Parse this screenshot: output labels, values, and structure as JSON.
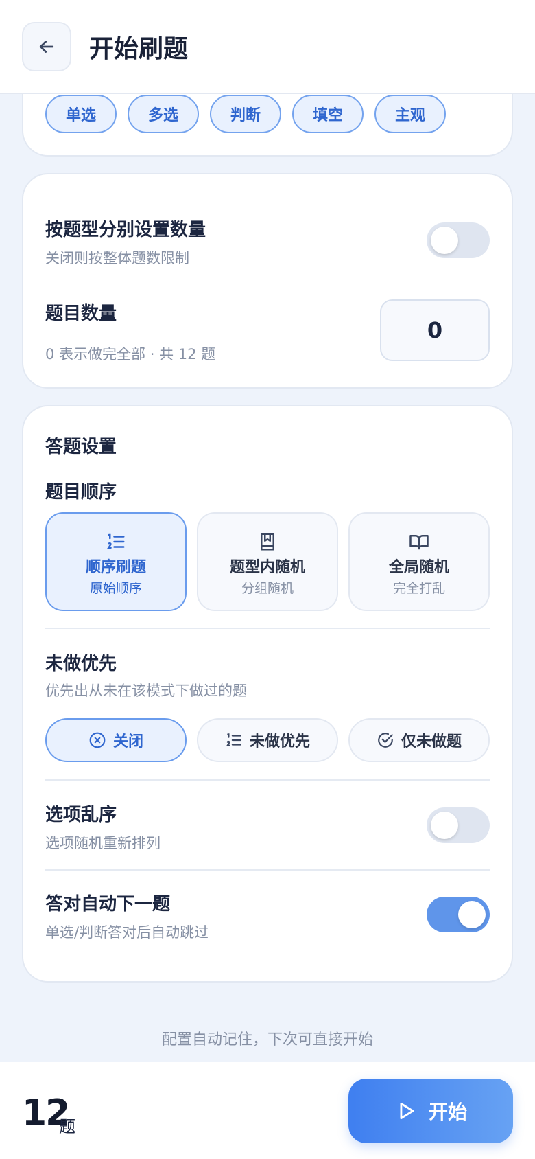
{
  "header": {
    "title": "开始刷题"
  },
  "question_types": {
    "chips": [
      "单选",
      "多选",
      "判断",
      "填空",
      "主观"
    ]
  },
  "quantity_card": {
    "per_type_title": "按题型分别设置数量",
    "per_type_sub": "关闭则按整体题数限制",
    "per_type_enabled": false,
    "count_title": "题目数量",
    "count_sub": "0 表示做完全部 · 共 12 题",
    "count_value": "0"
  },
  "answer_settings": {
    "section_title": "答题设置",
    "order_title": "题目顺序",
    "order_options": [
      {
        "label": "顺序刷题",
        "sub": "原始顺序",
        "icon": "numbered-list-icon",
        "selected": true
      },
      {
        "label": "题型内随机",
        "sub": "分组随机",
        "icon": "bookmark-book-icon",
        "selected": false
      },
      {
        "label": "全局随机",
        "sub": "完全打乱",
        "icon": "open-book-icon",
        "selected": false
      }
    ],
    "priority_title": "未做优先",
    "priority_sub": "优先出从未在该模式下做过的题",
    "priority_options": [
      {
        "label": "关闭",
        "icon": "x-circle-icon",
        "selected": true
      },
      {
        "label": "未做优先",
        "icon": "numbered-list-icon",
        "selected": false
      },
      {
        "label": "仅未做题",
        "icon": "check-circle-icon",
        "selected": false
      }
    ],
    "shuffle_title": "选项乱序",
    "shuffle_sub": "选项随机重新排列",
    "shuffle_enabled": false,
    "auto_next_title": "答对自动下一题",
    "auto_next_sub": "单选/判断答对后自动跳过",
    "auto_next_enabled": true
  },
  "footer_hint": "配置自动记住，下次可直接开始",
  "bottom": {
    "count": "12",
    "unit": "题",
    "start_label": "开始"
  },
  "colors": {
    "accent": "#3f7ff0",
    "accent_light": "#e9f1fe",
    "background": "#eef3fb"
  }
}
